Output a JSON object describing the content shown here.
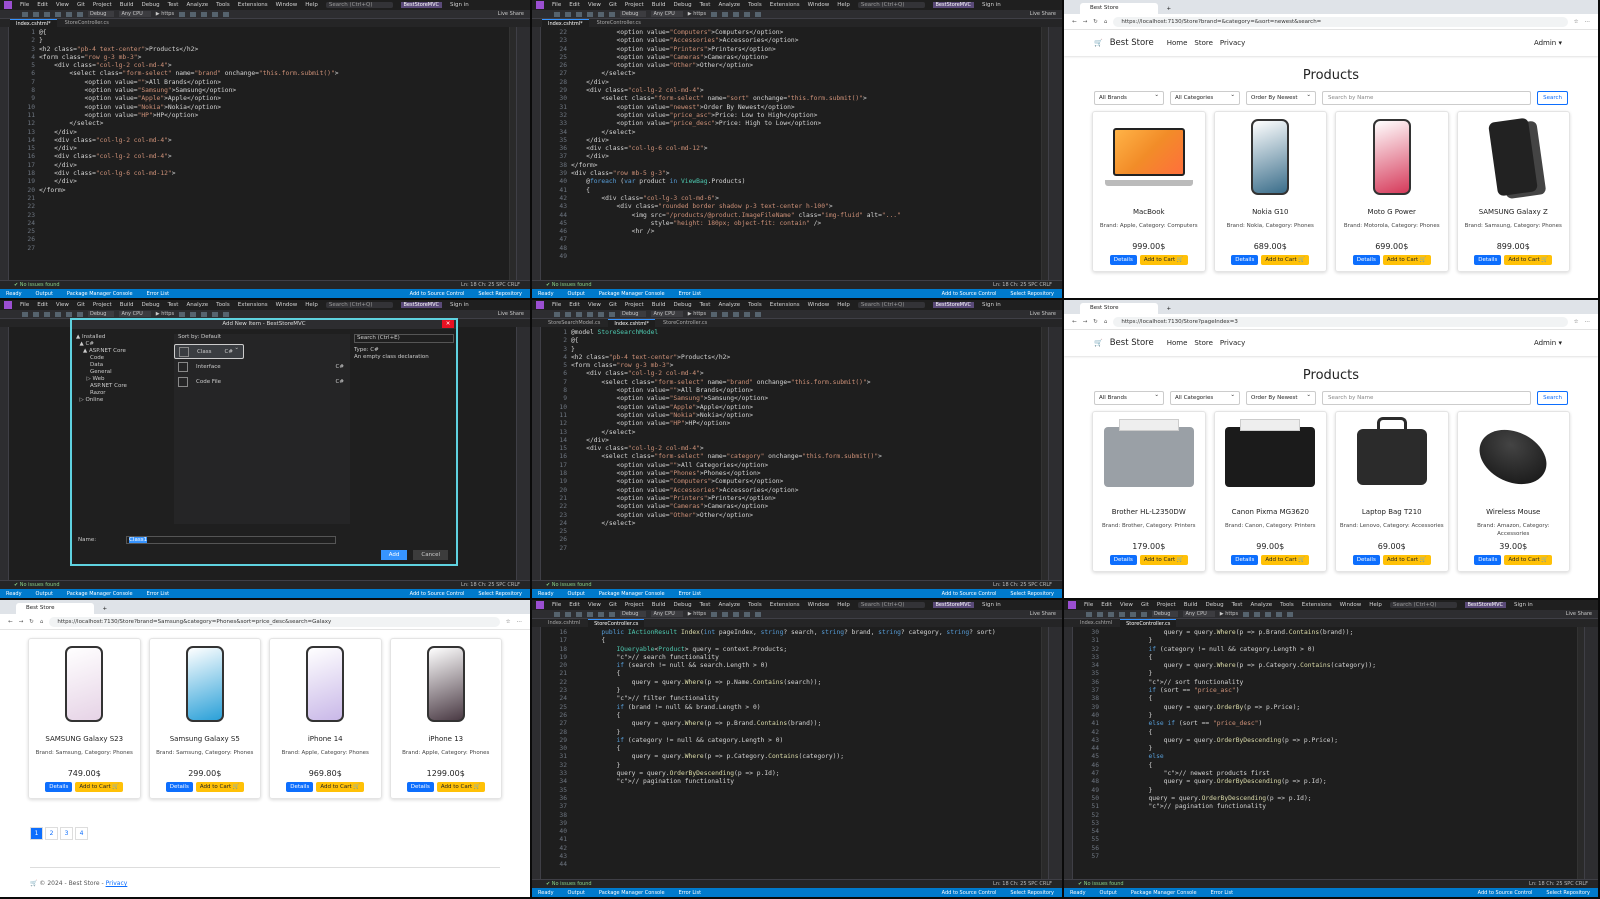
{
  "vs": {
    "menu": [
      "File",
      "Edit",
      "View",
      "Git",
      "Project",
      "Build",
      "Debug",
      "Test",
      "Analyze",
      "Tools",
      "Extensions",
      "Window",
      "Help"
    ],
    "search": "Search (Ctrl+Q)",
    "solution": "BestStoreMVC",
    "signin": "Sign in",
    "liveshare": "Live Share",
    "config": "Debug",
    "cpu": "Any CPU",
    "run": "https",
    "status_ok": "No issues found",
    "ln_col": "Ln: 18   Ch: 25   SPC   CRLF",
    "output_tabs": [
      "Output",
      "Package Manager Console",
      "Error List"
    ],
    "ready": "Ready",
    "add_src": "Add to Source Control",
    "select_repo": "Select Repository"
  },
  "p1": {
    "tabs": [
      "Index.cshtml*",
      "StoreController.cs"
    ],
    "lines": [
      "1",
      "2",
      "3",
      "4",
      "5",
      "6",
      "7",
      "8",
      "9",
      "10",
      "11",
      "12",
      "13",
      "14",
      "15",
      "16",
      "17",
      "18",
      "19",
      "20",
      "21",
      "22",
      "23",
      "24",
      "25",
      "26",
      "27"
    ],
    "code": [
      "",
      "@{",
      "}",
      "",
      "<h2 class=\"pb-4 text-center\">Products</h2>",
      "",
      "",
      "<form class=\"row g-3 mb-3\">",
      "    <div class=\"col-lg-2 col-md-4\">",
      "        <select class=\"form-select\" name=\"brand\" onchange=\"this.form.submit()\">",
      "            <option value=\"\">All Brands</option>",
      "            <option value=\"Samsung\">Samsung</option>",
      "            <option value=\"Apple\">Apple</option>",
      "            <option value=\"Nokia\">Nokia</option>",
      "            <option value=\"HP\">HP</option>",
      "        </select>",
      "    </div>",
      "    <div class=\"col-lg-2 col-md-4\">",
      "",
      "    </div>",
      "    <div class=\"col-lg-2 col-md-4\">",
      "",
      "    </div>",
      "    <div class=\"col-lg-6 col-md-12\">",
      "",
      "    </div>",
      "</form>"
    ]
  },
  "p2": {
    "tabs": [
      "Index.cshtml*",
      "StoreController.cs"
    ],
    "lines": [
      "22",
      "23",
      "24",
      "25",
      "26",
      "27",
      "28",
      "29",
      "30",
      "31",
      "32",
      "33",
      "34",
      "35",
      "36",
      "37",
      "38",
      "39",
      "40",
      "41",
      "42",
      "43",
      "44",
      "45",
      "46",
      "47",
      "48",
      "49"
    ],
    "code": [
      "            <option value=\"Computers\">Computers</option>",
      "            <option value=\"Accessories\">Accessories</option>",
      "            <option value=\"Printers\">Printers</option>",
      "            <option value=\"Cameras\">Cameras</option>",
      "            <option value=\"Other\">Other</option>",
      "        </select>",
      "    </div>",
      "    <div class=\"col-lg-2 col-md-4\">",
      "        <select class=\"form-select\" name=\"sort\" onchange=\"this.form.submit()\">",
      "            <option value=\"newest\">Order By Newest</option>",
      "            <option value=\"price_asc\">Price: Low to High</option>",
      "            <option value=\"price_desc\">Price: High to Low</option>",
      "        </select>",
      "    </div>",
      "    <div class=\"col-lg-6 col-md-12\">",
      "",
      "    </div>",
      "</form>",
      "",
      "<div class=\"row mb-5 g-3\">",
      "    @foreach (var product in ViewBag.Products)",
      "    {",
      "        <div class=\"col-lg-3 col-md-6\">",
      "            <div class=\"rounded border shadow p-3 text-center h-100\">",
      "                <img src=\"/products/@product.ImageFileName\" class=\"img-fluid\" alt=\"...\"",
      "                     style=\"height: 180px; object-fit: contain\" />",
      "                <hr />",
      ""
    ]
  },
  "p4": {
    "title": "Add New Item - BestStoreMVC",
    "tree": "▲ Installed\n  ▲ C#\n    ▲ ASP.NET Core\n        Code\n        Data\n        General\n      ▷ Web\n        ASP.NET Core\n        Razor\n  ▷ Online",
    "sort_by": "Sort by:  Default",
    "search": "Search (Ctrl+E)",
    "items": [
      {
        "name": "Class",
        "lang": "C#"
      },
      {
        "name": "Interface",
        "lang": "C#"
      },
      {
        "name": "Code File",
        "lang": "C#"
      }
    ],
    "type_label": "Type:  C#",
    "type_desc": "An empty class declaration",
    "name_label": "Name:",
    "name_value": "Class1",
    "add": "Add",
    "cancel": "Cancel"
  },
  "p5": {
    "tabs": [
      "StoreSearchModel.cs",
      "Index.cshtml*",
      "StoreController.cs"
    ],
    "lines": [
      "1",
      "2",
      "3",
      "4",
      "5",
      "6",
      "7",
      "8",
      "9",
      "10",
      "11",
      "12",
      "13",
      "14",
      "15",
      "16",
      "17",
      "18",
      "19",
      "20",
      "21",
      "22",
      "23",
      "24",
      "25",
      "26",
      "27"
    ],
    "code": [
      "@model StoreSearchModel",
      "@{",
      "}",
      "",
      "<h2 class=\"pb-4 text-center\">Products</h2>",
      "",
      "",
      "<form class=\"row g-3 mb-3\">",
      "    <div class=\"col-lg-2 col-md-4\">",
      "        <select class=\"form-select\" name=\"brand\" onchange=\"this.form.submit()\">",
      "            <option value=\"\">All Brands</option>",
      "            <option value=\"Samsung\">Samsung</option>",
      "            <option value=\"Apple\">Apple</option>",
      "            <option value=\"Nokia\">Nokia</option>",
      "            <option value=\"HP\">HP</option>",
      "        </select>",
      "    </div>",
      "    <div class=\"col-lg-2 col-md-4\">",
      "        <select class=\"form-select\" name=\"category\" onchange=\"this.form.submit()\">",
      "            <option value=\"\">All Categories</option>",
      "            <option value=\"Phones\">Phones</option>",
      "            <option value=\"Computers\">Computers</option>",
      "            <option value=\"Accessories\">Accessories</option>",
      "            <option value=\"Printers\">Printers</option>",
      "            <option value=\"Cameras\">Cameras</option>",
      "            <option value=\"Other\">Other</option>",
      "        </select>"
    ]
  },
  "p8": {
    "tabs": [
      "Index.cshtml",
      "StoreController.cs"
    ],
    "lines": [
      "16",
      "17",
      "18",
      "19",
      "20",
      "21",
      "22",
      "23",
      "24",
      "25",
      "26",
      "27",
      "28",
      "29",
      "30",
      "31",
      "32",
      "33",
      "34",
      "35",
      "36",
      "37",
      "38",
      "39",
      "40",
      "41",
      "42",
      "43",
      "44"
    ],
    "code": [
      "",
      "        public IActionResult Index(int pageIndex, string? search, string? brand, string? category, string? sort)",
      "        {",
      "            IQueryable<Product> query = context.Products;",
      "",
      "            // search functionality",
      "            if (search != null && search.Length > 0)",
      "            {",
      "                query = query.Where(p => p.Name.Contains(search));",
      "            }",
      "",
      "",
      "            // filter functionality",
      "            if (brand != null && brand.Length > 0)",
      "            {",
      "                query = query.Where(p => p.Brand.Contains(brand));",
      "            }",
      "",
      "            if (category != null && category.Length > 0)",
      "            {",
      "                query = query.Where(p => p.Category.Contains(category));",
      "            }",
      "",
      "            query = query.OrderByDescending(p => p.Id);",
      "",
      "            // pagination functionality"
    ]
  },
  "p9": {
    "tabs": [
      "Index.cshtml",
      "StoreController.cs"
    ],
    "lines": [
      "30",
      "31",
      "32",
      "33",
      "34",
      "35",
      "36",
      "37",
      "38",
      "39",
      "40",
      "41",
      "42",
      "43",
      "44",
      "45",
      "46",
      "47",
      "48",
      "49",
      "50",
      "51",
      "52",
      "53",
      "54",
      "55",
      "56",
      "57"
    ],
    "code": [
      "                query = query.Where(p => p.Brand.Contains(brand));",
      "            }",
      "",
      "            if (category != null && category.Length > 0)",
      "            {",
      "                query = query.Where(p => p.Category.Contains(category));",
      "            }",
      "",
      "            // sort functionality",
      "            if (sort == \"price_asc\")",
      "            {",
      "                query = query.OrderBy(p => p.Price);",
      "            }",
      "            else if (sort == \"price_desc\")",
      "            {",
      "                query = query.OrderByDescending(p => p.Price);",
      "            }",
      "            else",
      "            {",
      "                // newest products first",
      "                query = query.OrderByDescending(p => p.Id);",
      "            }",
      "",
      "            query = query.OrderByDescending(p => p.Id);",
      "",
      "            // pagination functionality"
    ]
  },
  "store": {
    "tab": "Best Store",
    "brand": "Best Store",
    "nav": [
      "Home",
      "Store",
      "Privacy"
    ],
    "admin": "Admin",
    "title": "Products",
    "filters": [
      "All Brands",
      "All Categories",
      "Order By Newest"
    ],
    "search_placeholder": "Search by Name",
    "search_btn": "Search",
    "details": "Details",
    "add_cart": "Add to Cart",
    "footer": "© 2024 - Best Store - ",
    "privacy": "Privacy"
  },
  "p3": {
    "url": "https://localhost:7130/Store?brand=&category=&sort=newest&search=",
    "products": [
      {
        "name": "MacBook",
        "info": "Brand: Apple, Category: Computers",
        "price": "999.00$",
        "color": "#f28c28"
      },
      {
        "name": "Nokia G10",
        "info": "Brand: Nokia, Category: Phones",
        "price": "689.00$",
        "color": "#3a6d8a"
      },
      {
        "name": "Moto G Power",
        "info": "Brand: Motorola, Category: Phones",
        "price": "699.00$",
        "color": "#d63a5a"
      },
      {
        "name": "SAMSUNG Galaxy Z",
        "info": "Brand: Samsung, Category: Phones",
        "price": "899.00$",
        "color": "#222"
      }
    ]
  },
  "p6": {
    "url": "https://localhost:7130/Store?pageIndex=3",
    "products": [
      {
        "name": "Brother HL-L2350DW",
        "info": "Brand: Brother, Category: Printers",
        "price": "179.00$",
        "color": "#9aa0a6"
      },
      {
        "name": "Canon Pixma MG3620",
        "info": "Brand: Canon, Category: Printers",
        "price": "99.00$",
        "color": "#1b1b1b"
      },
      {
        "name": "Laptop Bag T210",
        "info": "Brand: Lenovo, Category: Accessories",
        "price": "69.00$",
        "color": "#2b2b2b"
      },
      {
        "name": "Wireless Mouse",
        "info": "Brand: Amazon, Category: Accessories",
        "price": "39.00$",
        "color": "#111"
      }
    ]
  },
  "p7": {
    "url": "https://localhost:7130/Store?brand=Samsung&category=Phones&sort=price_desc&search=Galaxy",
    "products": [
      {
        "name": "SAMSUNG Galaxy S23",
        "info": "Brand: Samsung, Category: Phones",
        "price": "749.00$",
        "color": "#e6d3e6"
      },
      {
        "name": "Samsung Galaxy S5",
        "info": "Brand: Samsung, Category: Phones",
        "price": "299.00$",
        "color": "#2aa0d8"
      },
      {
        "name": "iPhone 14",
        "info": "Brand: Apple, Category: Phones",
        "price": "969.80$",
        "color": "#c9b8e8"
      },
      {
        "name": "iPhone 13",
        "info": "Brand: Apple, Category: Phones",
        "price": "1299.00$",
        "color": "#4a3a44"
      }
    ],
    "pages": [
      "1",
      "2",
      "3",
      "4"
    ]
  }
}
